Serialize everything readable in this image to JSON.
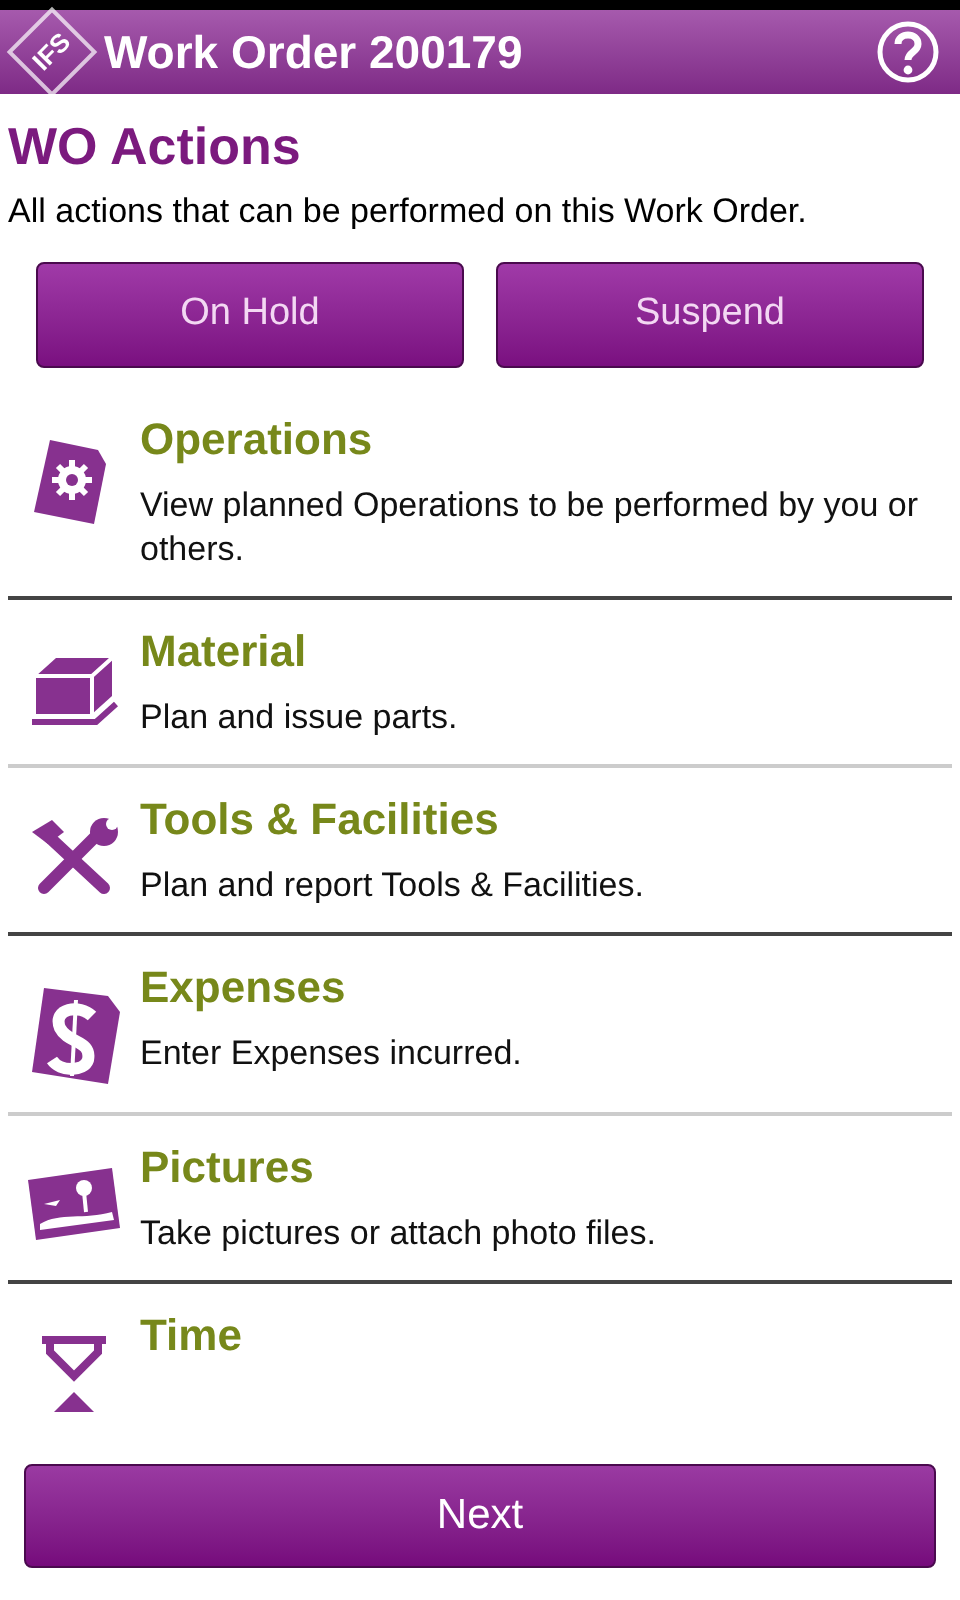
{
  "app_bar": {
    "logo_text": "IFS",
    "title": "Work Order 200179"
  },
  "heading": "WO Actions",
  "description": "All actions that can be performed on this Work Order.",
  "buttons": [
    "On Hold",
    "Suspend"
  ],
  "actions": [
    {
      "kind": "operations",
      "title": "Operations",
      "description": "View planned Operations to be performed by you or others."
    },
    {
      "kind": "material",
      "title": "Material",
      "description": "Plan and issue parts."
    },
    {
      "kind": "tools",
      "title": "Tools & Facilities",
      "description": "Plan and report Tools & Facilities."
    },
    {
      "kind": "expenses",
      "title": "Expenses",
      "description": "Enter Expenses incurred."
    },
    {
      "kind": "pictures",
      "title": "Pictures",
      "description": "Take pictures or attach photo files."
    },
    {
      "kind": "time",
      "title": "Time"
    }
  ],
  "footer_button": "Next"
}
